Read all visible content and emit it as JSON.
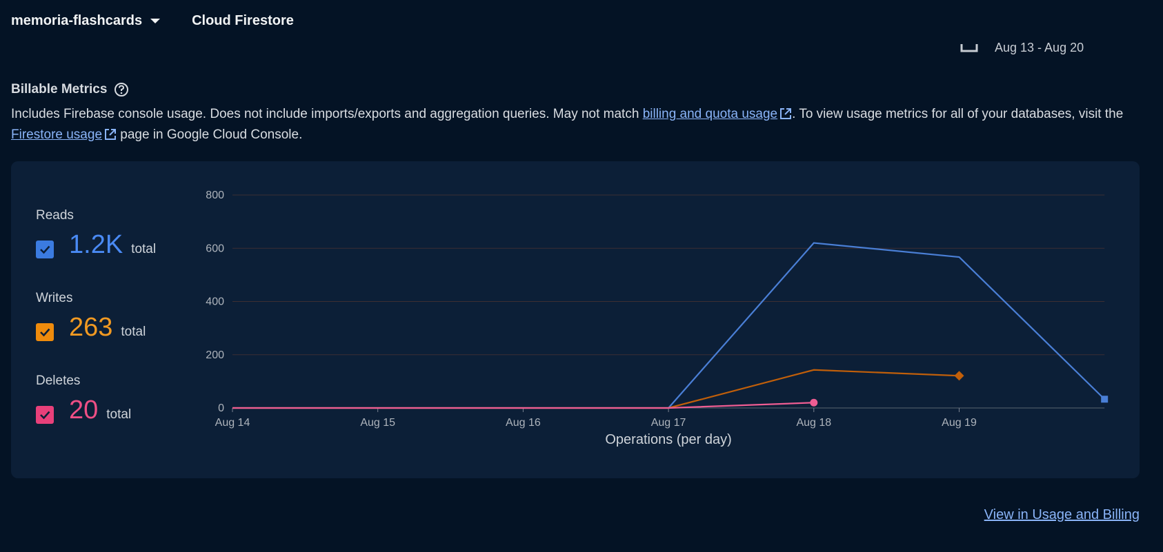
{
  "header": {
    "project": "memoria-flashcards",
    "product": "Cloud Firestore"
  },
  "date_range": "Aug 13 - Aug 20",
  "section": {
    "title": "Billable Metrics",
    "desc_part1": "Includes Firebase console usage. Does not include imports/exports and aggregation queries. May not match ",
    "link1": "billing and quota usage",
    "desc_part2": ". To view usage metrics for all of your databases, visit the ",
    "link2": "Firestore usage",
    "desc_part3": " page in Google Cloud Console."
  },
  "metrics": [
    {
      "label": "Reads",
      "value": "1.2K",
      "suffix": "total",
      "color": "#3b7be0",
      "text_color": "#4a8af4"
    },
    {
      "label": "Writes",
      "value": "263",
      "suffix": "total",
      "color": "#ef8b0c",
      "text_color": "#f29a22"
    },
    {
      "label": "Deletes",
      "value": "20",
      "suffix": "total",
      "color": "#e8407a",
      "text_color": "#ee4f85"
    }
  ],
  "chart_data": {
    "type": "line",
    "categories": [
      "Aug 14",
      "Aug 15",
      "Aug 16",
      "Aug 17",
      "Aug 18",
      "Aug 19",
      "Aug 20"
    ],
    "tick_labels": [
      "Aug 14",
      "Aug 15",
      "Aug 16",
      "Aug 17",
      "Aug 18",
      "Aug 19"
    ],
    "y_ticks": [
      0,
      200,
      400,
      600,
      800
    ],
    "ylim": [
      0,
      800
    ],
    "xlabel": "Operations (per day)",
    "ylabel": "",
    "grid": true,
    "series": [
      {
        "name": "Reads",
        "color": "#4a7fd6",
        "marker": "square",
        "values": [
          0,
          0,
          0,
          0,
          620,
          567,
          33
        ]
      },
      {
        "name": "Writes",
        "color": "#c15f0a",
        "marker": "diamond",
        "values": [
          0,
          0,
          0,
          0,
          143,
          121
        ]
      },
      {
        "name": "Deletes",
        "color": "#ef5d92",
        "marker": "circle",
        "values": [
          0,
          0,
          0,
          0,
          20
        ]
      }
    ]
  },
  "footer": {
    "link": "View in Usage and Billing"
  }
}
